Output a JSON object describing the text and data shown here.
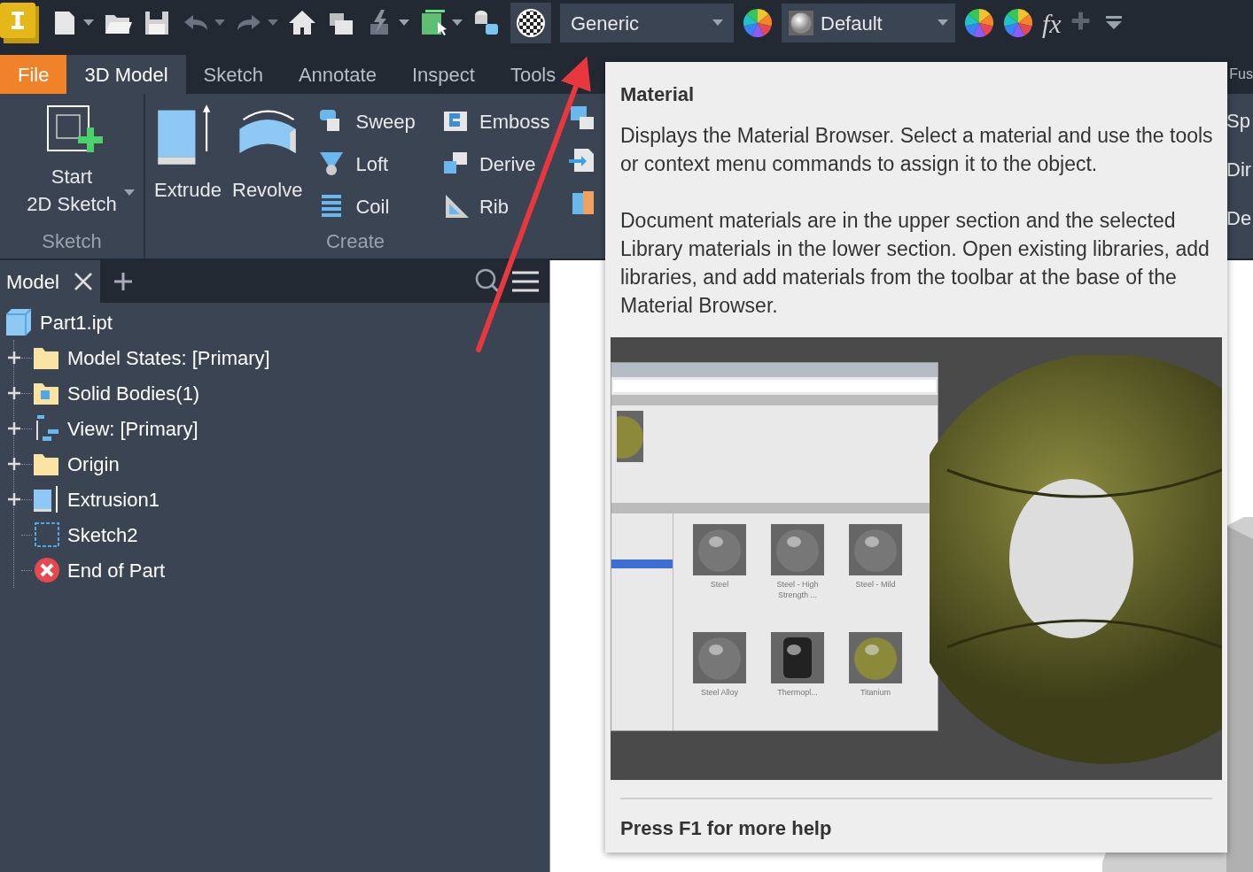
{
  "toolbar": {
    "style_dropdown": "Generic",
    "appearance_dropdown": "Default",
    "function_label": "fx"
  },
  "ribbon_tabs": [
    {
      "label": "File",
      "kind": "file",
      "selected": false
    },
    {
      "label": "3D Model",
      "kind": "tab",
      "selected": true
    },
    {
      "label": "Sketch",
      "kind": "tab",
      "selected": false
    },
    {
      "label": "Annotate",
      "kind": "tab",
      "selected": false
    },
    {
      "label": "Inspect",
      "kind": "tab",
      "selected": false
    },
    {
      "label": "Tools",
      "kind": "tab",
      "selected": false
    },
    {
      "label": "Fus",
      "kind": "tab",
      "selected": false
    }
  ],
  "ribbon": {
    "sketch_panel": {
      "title": "Sketch",
      "button_lines": [
        "Start",
        "2D Sketch"
      ]
    },
    "create_panel": {
      "title": "Create",
      "large_buttons": [
        {
          "label": "Extrude",
          "kind": "extrude"
        },
        {
          "label": "Revolve",
          "kind": "revolve"
        }
      ],
      "small_buttons": [
        {
          "label": "Sweep",
          "kind": "sweep"
        },
        {
          "label": "Loft",
          "kind": "loft"
        },
        {
          "label": "Coil",
          "kind": "coil"
        },
        {
          "label": "Emboss",
          "kind": "emboss"
        },
        {
          "label": "Derive",
          "kind": "derive"
        },
        {
          "label": "Rib",
          "kind": "rib"
        }
      ]
    },
    "hidden_panel_items": [
      "Sp",
      "Dir",
      "De"
    ]
  },
  "browser": {
    "tab": "Model",
    "root": "Part1.ipt",
    "children": [
      {
        "label": "Model States: [Primary]",
        "kind": "folder",
        "expandable": true
      },
      {
        "label": "Solid Bodies(1)",
        "kind": "bodies",
        "expandable": true
      },
      {
        "label": "View: [Primary]",
        "kind": "view",
        "expandable": true
      },
      {
        "label": "Origin",
        "kind": "folder",
        "expandable": true
      },
      {
        "label": "Extrusion1",
        "kind": "extrusion",
        "expandable": true
      },
      {
        "label": "Sketch2",
        "kind": "sketch",
        "expandable": false
      },
      {
        "label": "End of Part",
        "kind": "end",
        "expandable": false
      }
    ]
  },
  "tooltip": {
    "title": "Material",
    "paragraphs": [
      "Displays the Material Browser. Select a material and use the tools or context menu commands to assign it to the object.",
      "Document materials are in the upper section and the selected Library materials in the lower section. Open existing libraries, add libraries, and add materials from the toolbar at the base of the Material Browser."
    ],
    "thumbnails": [
      {
        "label": "Steel",
        "kind": "metal"
      },
      {
        "label": "Steel - High Strength ...",
        "kind": "metal"
      },
      {
        "label": "Steel - Mild",
        "kind": "metal"
      },
      {
        "label": "Steel Alloy",
        "kind": "metal"
      },
      {
        "label": "Thermopl...",
        "kind": "plastic"
      },
      {
        "label": "Titanium",
        "kind": "gold"
      }
    ],
    "footer": "Press F1 for more help"
  }
}
